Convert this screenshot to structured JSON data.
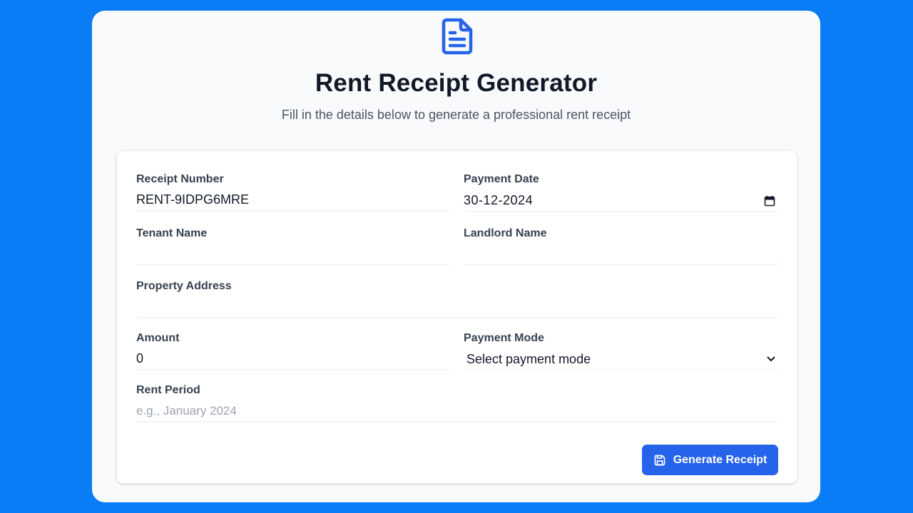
{
  "header": {
    "icon": "document-icon",
    "title": "Rent Receipt Generator",
    "subtitle": "Fill in the details below to generate a professional rent receipt"
  },
  "form": {
    "receipt_number": {
      "label": "Receipt Number",
      "value": "RENT-9IDPG6MRE"
    },
    "payment_date": {
      "label": "Payment Date",
      "value": "30-12-2024",
      "icon": "calendar-icon"
    },
    "tenant_name": {
      "label": "Tenant Name",
      "value": ""
    },
    "landlord_name": {
      "label": "Landlord Name",
      "value": ""
    },
    "property_address": {
      "label": "Property Address",
      "value": ""
    },
    "amount": {
      "label": "Amount",
      "value": "0"
    },
    "payment_mode": {
      "label": "Payment Mode",
      "selected": "Select payment mode",
      "icon": "chevron-down-icon"
    },
    "rent_period": {
      "label": "Rent Period",
      "value": "",
      "placeholder": "e.g., January 2024"
    }
  },
  "actions": {
    "generate_label": "Generate Receipt",
    "generate_icon": "save-icon"
  },
  "colors": {
    "background": "#0a7cf5",
    "card": "#f8fafc",
    "accent": "#2563eb",
    "icon": "#2563eb"
  }
}
